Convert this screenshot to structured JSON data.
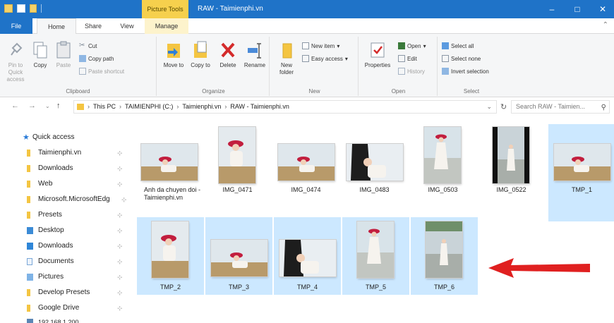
{
  "titlebar": {
    "picture_tools": "Picture Tools",
    "title": "RAW - Taimienphi.vn",
    "minimize": "–",
    "maximize": "□",
    "close": "✕"
  },
  "tabs": {
    "file": "File",
    "home": "Home",
    "share": "Share",
    "view": "View",
    "manage": "Manage"
  },
  "ribbon": {
    "clipboard": {
      "label": "Clipboard",
      "pin": "Pin to Quick access",
      "copy": "Copy",
      "paste": "Paste",
      "cut": "Cut",
      "copy_path": "Copy path",
      "paste_shortcut": "Paste shortcut"
    },
    "organize": {
      "label": "Organize",
      "move_to": "Move to",
      "copy_to": "Copy to",
      "delete": "Delete",
      "rename": "Rename"
    },
    "new": {
      "label": "New",
      "new_folder": "New folder",
      "new_item": "New item",
      "easy_access": "Easy access"
    },
    "open": {
      "label": "Open",
      "properties": "Properties",
      "open": "Open",
      "edit": "Edit",
      "history": "History"
    },
    "select": {
      "label": "Select",
      "select_all": "Select all",
      "select_none": "Select none",
      "invert": "Invert selection"
    }
  },
  "address": {
    "this_pc": "This PC",
    "drive": "TAIMIENPHI (C:)",
    "folder1": "Taimienphi.vn",
    "folder2": "RAW - Taimienphi.vn",
    "search_placeholder": "Search RAW - Taimien..."
  },
  "nav": [
    {
      "label": "Quick access",
      "icon": "star-icon",
      "pinned": false
    },
    {
      "label": "Taimienphi.vn",
      "icon": "folder-icon",
      "pinned": true
    },
    {
      "label": "Downloads",
      "icon": "folder-icon",
      "pinned": true
    },
    {
      "label": "Web",
      "icon": "folder-icon",
      "pinned": true
    },
    {
      "label": "Microsoft.MicrosoftEdg",
      "icon": "folder-icon",
      "pinned": true
    },
    {
      "label": "Presets",
      "icon": "folder-icon",
      "pinned": true
    },
    {
      "label": "Desktop",
      "icon": "desktop-icon",
      "pinned": true
    },
    {
      "label": "Downloads",
      "icon": "downloads-icon",
      "pinned": true
    },
    {
      "label": "Documents",
      "icon": "documents-icon",
      "pinned": true
    },
    {
      "label": "Pictures",
      "icon": "pictures-icon",
      "pinned": true
    },
    {
      "label": "Develop Presets",
      "icon": "folder-icon",
      "pinned": true
    },
    {
      "label": "Google Drive",
      "icon": "folder-icon",
      "pinned": true
    },
    {
      "label": "192.168.1.200",
      "icon": "network-icon",
      "pinned": false
    }
  ],
  "files": [
    {
      "name": "Anh da chuyen doi - Taimienphi.vn",
      "selected": false
    },
    {
      "name": "IMG_0471",
      "selected": false
    },
    {
      "name": "IMG_0474",
      "selected": false
    },
    {
      "name": "IMG_0483",
      "selected": false
    },
    {
      "name": "IMG_0503",
      "selected": false
    },
    {
      "name": "IMG_0522",
      "selected": false
    },
    {
      "name": "TMP_1",
      "selected": true
    },
    {
      "name": "TMP_2",
      "selected": true
    },
    {
      "name": "TMP_3",
      "selected": true
    },
    {
      "name": "TMP_4",
      "selected": true
    },
    {
      "name": "TMP_5",
      "selected": true
    },
    {
      "name": "TMP_6",
      "selected": true
    }
  ],
  "colors": {
    "accent": "#1f73c8",
    "selection": "#cce8ff",
    "picture_tools": "#f6d04d",
    "arrow": "#e02020"
  }
}
